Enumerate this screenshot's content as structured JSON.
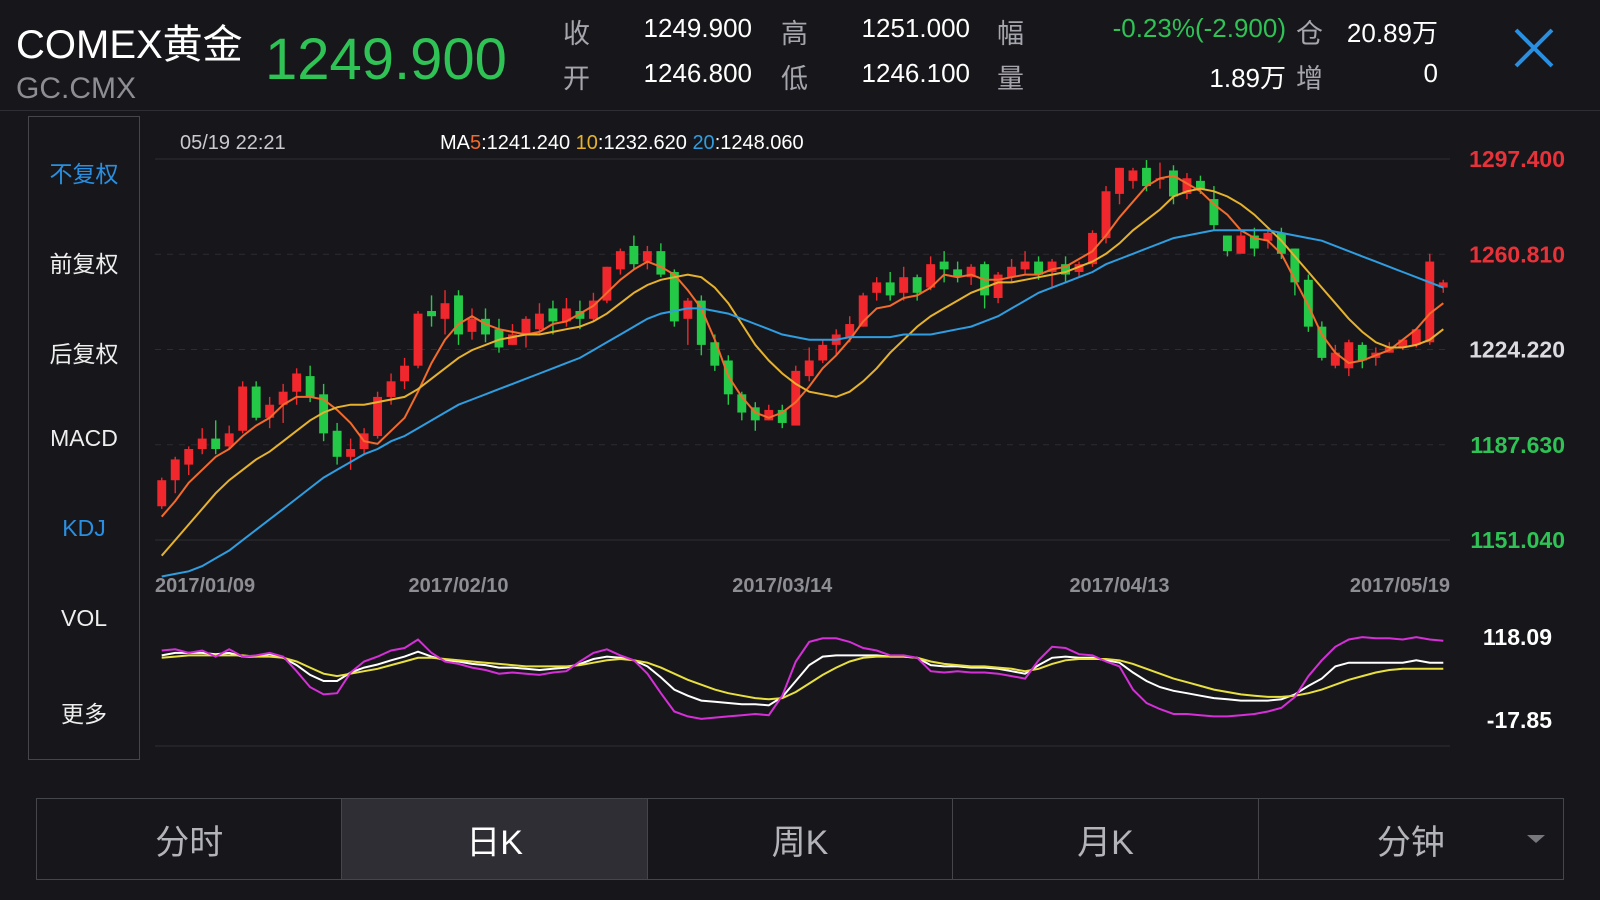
{
  "header": {
    "name": "COMEX黄金",
    "code": "GC.CMX",
    "price": "1249.900",
    "quote": [
      {
        "label": "收",
        "value": "1249.900"
      },
      {
        "label": "高",
        "value": "1251.000"
      },
      {
        "label": "幅",
        "value": "-0.23%(-2.900)"
      },
      {
        "label": "仓",
        "value": "20.89万"
      },
      {
        "label": "开",
        "value": "1246.800"
      },
      {
        "label": "低",
        "value": "1246.100"
      },
      {
        "label": "量",
        "value": "1.89万"
      },
      {
        "label": "增",
        "value": "0"
      }
    ]
  },
  "sidebar": {
    "items": [
      {
        "label": "不复权",
        "active": true
      },
      {
        "label": "前复权",
        "active": false
      },
      {
        "label": "后复权",
        "active": false
      },
      {
        "label": "MACD",
        "active": false
      },
      {
        "label": "KDJ",
        "active": true
      },
      {
        "label": "VOL",
        "active": false
      },
      {
        "label": "更多",
        "active": false
      }
    ]
  },
  "tabs": [
    {
      "label": "分时",
      "active": false
    },
    {
      "label": "日K",
      "active": true
    },
    {
      "label": "周K",
      "active": false
    },
    {
      "label": "月K",
      "active": false
    },
    {
      "label": "分钟",
      "active": false,
      "dropdown": true
    }
  ],
  "colors": {
    "up": "#f0282d",
    "down": "#25c948",
    "ma5": "#f36a2a",
    "ma10": "#e6b22e",
    "ma20": "#2f9de0",
    "kdj_k": "#ffffff",
    "kdj_d": "#e8e040",
    "kdj_j": "#d62fd8",
    "accent": "#2a8fe0",
    "price_text": "#2fc255",
    "grid": "#2c2c33"
  },
  "chart_data": [
    {
      "type": "candlestick",
      "timestamp": "05/19 22:21",
      "ma": {
        "prefix": "MA",
        "items": [
          {
            "period": "5",
            "value": "1241.240"
          },
          {
            "period": "10",
            "value": "1232.620"
          },
          {
            "period": "20",
            "value": "1248.060"
          }
        ]
      },
      "ylim": [
        1151.04,
        1297.4
      ],
      "y_ticks": [
        "1297.400",
        "1260.810",
        "1224.220",
        "1187.630",
        "1151.040"
      ],
      "x_ticks": [
        "2017/01/09",
        "2017/02/10",
        "2017/03/14",
        "2017/04/13",
        "2017/05/19"
      ],
      "x_tick_index": [
        0,
        22,
        46,
        71,
        93
      ],
      "candles": [
        [
          1164,
          1174,
          1163,
          1175
        ],
        [
          1174,
          1182,
          1169,
          1183
        ],
        [
          1180,
          1186,
          1176,
          1187
        ],
        [
          1186,
          1190,
          1184,
          1194
        ],
        [
          1190,
          1186,
          1184,
          1197
        ],
        [
          1187,
          1192,
          1186,
          1195
        ],
        [
          1193,
          1210,
          1192,
          1212
        ],
        [
          1210,
          1198,
          1197,
          1212
        ],
        [
          1198,
          1203,
          1194,
          1206
        ],
        [
          1203,
          1208,
          1196,
          1211
        ],
        [
          1208,
          1215,
          1203,
          1217
        ],
        [
          1214,
          1206,
          1204,
          1218
        ],
        [
          1207,
          1192,
          1189,
          1211
        ],
        [
          1193,
          1183,
          1180,
          1196
        ],
        [
          1183,
          1186,
          1178,
          1190
        ],
        [
          1186,
          1192,
          1184,
          1194
        ],
        [
          1191,
          1206,
          1190,
          1208
        ],
        [
          1206,
          1212,
          1203,
          1215
        ],
        [
          1212,
          1218,
          1209,
          1221
        ],
        [
          1218,
          1238,
          1217,
          1239
        ],
        [
          1239,
          1237,
          1233,
          1245
        ],
        [
          1236,
          1242,
          1230,
          1247
        ],
        [
          1245,
          1230,
          1226,
          1247
        ],
        [
          1231,
          1236,
          1228,
          1240
        ],
        [
          1236,
          1230,
          1227,
          1240
        ],
        [
          1232,
          1225,
          1223,
          1236
        ],
        [
          1226,
          1230,
          1226,
          1234
        ],
        [
          1230,
          1236,
          1225,
          1237
        ],
        [
          1232,
          1238,
          1230,
          1242
        ],
        [
          1240,
          1235,
          1230,
          1243
        ],
        [
          1235,
          1240,
          1233,
          1244
        ],
        [
          1239,
          1236,
          1232,
          1243
        ],
        [
          1236,
          1243,
          1235,
          1246
        ],
        [
          1243,
          1256,
          1242,
          1256
        ],
        [
          1255,
          1262,
          1253,
          1263
        ],
        [
          1264,
          1257,
          1255,
          1268
        ],
        [
          1258,
          1262,
          1255,
          1264
        ],
        [
          1262,
          1253,
          1252,
          1265
        ],
        [
          1254,
          1235,
          1233,
          1255
        ],
        [
          1236,
          1243,
          1226,
          1244
        ],
        [
          1243,
          1226,
          1222,
          1245
        ],
        [
          1227,
          1218,
          1216,
          1230
        ],
        [
          1220,
          1207,
          1203,
          1222
        ],
        [
          1207,
          1200,
          1197,
          1208
        ],
        [
          1202,
          1197,
          1193,
          1204
        ],
        [
          1197,
          1201,
          1197,
          1203
        ],
        [
          1201,
          1196,
          1194,
          1203
        ],
        [
          1195,
          1216,
          1196,
          1218
        ],
        [
          1214,
          1220,
          1212,
          1225
        ],
        [
          1220,
          1226,
          1219,
          1228
        ],
        [
          1226,
          1230,
          1222,
          1232
        ],
        [
          1229,
          1234,
          1227,
          1237
        ],
        [
          1233,
          1245,
          1233,
          1246
        ],
        [
          1246,
          1250,
          1243,
          1252
        ],
        [
          1250,
          1245,
          1243,
          1254
        ],
        [
          1246,
          1252,
          1243,
          1256
        ],
        [
          1252,
          1246,
          1243,
          1253
        ],
        [
          1248,
          1257,
          1247,
          1260
        ],
        [
          1258,
          1255,
          1250,
          1262
        ],
        [
          1255,
          1252,
          1250,
          1258
        ],
        [
          1252,
          1256,
          1249,
          1257
        ],
        [
          1257,
          1245,
          1240,
          1258
        ],
        [
          1244,
          1253,
          1242,
          1254
        ],
        [
          1252,
          1256,
          1250,
          1259
        ],
        [
          1255,
          1258,
          1253,
          1262
        ],
        [
          1258,
          1253,
          1251,
          1260
        ],
        [
          1254,
          1258,
          1248,
          1259
        ],
        [
          1257,
          1253,
          1250,
          1260
        ],
        [
          1254,
          1257,
          1252,
          1258
        ],
        [
          1257,
          1269,
          1256,
          1270
        ],
        [
          1267,
          1285,
          1265,
          1287
        ],
        [
          1284,
          1294,
          1280,
          1294
        ],
        [
          1289,
          1293,
          1286,
          1294
        ],
        [
          1294,
          1287,
          1285,
          1297
        ],
        [
          1290,
          1290,
          1286,
          1296
        ],
        [
          1293,
          1283,
          1280,
          1295
        ],
        [
          1284,
          1290,
          1282,
          1292
        ],
        [
          1289,
          1286,
          1284,
          1291
        ],
        [
          1282,
          1272,
          1270,
          1287
        ],
        [
          1268,
          1262,
          1260,
          1268
        ],
        [
          1261,
          1268,
          1262,
          1270
        ],
        [
          1268,
          1263,
          1260,
          1271
        ],
        [
          1266,
          1269,
          1263,
          1270
        ],
        [
          1269,
          1261,
          1259,
          1271
        ],
        [
          1263,
          1250,
          1245,
          1263
        ],
        [
          1251,
          1233,
          1231,
          1253
        ],
        [
          1233,
          1221,
          1220,
          1235
        ],
        [
          1218,
          1223,
          1217,
          1226
        ],
        [
          1217,
          1227,
          1214,
          1228
        ],
        [
          1226,
          1220,
          1217,
          1227
        ],
        [
          1221,
          1223,
          1218,
          1225
        ],
        [
          1223,
          1225,
          1223,
          1227
        ],
        [
          1225,
          1228,
          1224,
          1228
        ],
        [
          1226,
          1232,
          1225,
          1232
        ],
        [
          1227,
          1258,
          1226,
          1261
        ],
        [
          1248,
          1250,
          1246,
          1251
        ]
      ],
      "ma5": [
        1160,
        1166,
        1173,
        1178,
        1183,
        1186,
        1191,
        1195,
        1198,
        1203,
        1206,
        1206,
        1205,
        1201,
        1196,
        1189,
        1188,
        1193,
        1198,
        1208,
        1219,
        1228,
        1234,
        1237,
        1234,
        1232,
        1231,
        1230,
        1231,
        1234,
        1235,
        1238,
        1241,
        1246,
        1251,
        1255,
        1258,
        1256,
        1253,
        1247,
        1240,
        1228,
        1214,
        1206,
        1200,
        1198,
        1200,
        1204,
        1210,
        1217,
        1222,
        1228,
        1235,
        1240,
        1241,
        1244,
        1245,
        1248,
        1253,
        1252,
        1253,
        1251,
        1251,
        1252,
        1253,
        1253,
        1255,
        1256,
        1259,
        1262,
        1268,
        1275,
        1281,
        1287,
        1290,
        1291,
        1288,
        1285,
        1280,
        1276,
        1270,
        1267,
        1266,
        1261,
        1251,
        1241,
        1230,
        1223,
        1219,
        1220,
        1222,
        1224,
        1228,
        1232,
        1238,
        1242
      ],
      "ma10": [
        1145,
        1151,
        1157,
        1163,
        1169,
        1174,
        1178,
        1182,
        1185,
        1189,
        1193,
        1197,
        1200,
        1202,
        1203,
        1203,
        1204,
        1205,
        1206,
        1209,
        1213,
        1217,
        1221,
        1224,
        1226,
        1228,
        1229,
        1230,
        1230,
        1231,
        1232,
        1233,
        1235,
        1238,
        1242,
        1246,
        1249,
        1251,
        1252,
        1253,
        1252,
        1248,
        1242,
        1234,
        1226,
        1220,
        1215,
        1211,
        1208,
        1207,
        1206,
        1208,
        1212,
        1217,
        1223,
        1228,
        1233,
        1237,
        1240,
        1243,
        1246,
        1248,
        1250,
        1250,
        1251,
        1252,
        1253,
        1254,
        1256,
        1258,
        1261,
        1265,
        1270,
        1274,
        1278,
        1283,
        1285,
        1286,
        1285,
        1283,
        1280,
        1276,
        1271,
        1266,
        1260,
        1254,
        1248,
        1242,
        1236,
        1231,
        1227,
        1225,
        1225,
        1226,
        1228,
        1232
      ],
      "ma20": [
        1137,
        1138,
        1139,
        1141,
        1144,
        1147,
        1151,
        1155,
        1159,
        1163,
        1167,
        1171,
        1175,
        1178,
        1181,
        1184,
        1186,
        1189,
        1191,
        1194,
        1197,
        1200,
        1203,
        1205,
        1207,
        1209,
        1211,
        1213,
        1215,
        1217,
        1219,
        1221,
        1224,
        1227,
        1230,
        1233,
        1236,
        1238,
        1239,
        1240,
        1240,
        1239,
        1238,
        1236,
        1234,
        1232,
        1230,
        1229,
        1228,
        1228,
        1228,
        1229,
        1229,
        1229,
        1229,
        1230,
        1230,
        1230,
        1231,
        1232,
        1233,
        1235,
        1237,
        1240,
        1243,
        1246,
        1248,
        1250,
        1252,
        1254,
        1257,
        1259,
        1261,
        1263,
        1265,
        1267,
        1268,
        1269,
        1270,
        1270,
        1270,
        1270,
        1270,
        1269,
        1268,
        1267,
        1266,
        1264,
        1262,
        1260,
        1258,
        1256,
        1254,
        1252,
        1250,
        1248
      ]
    },
    {
      "type": "line",
      "name": "KDJ",
      "ylim": [
        -17.85,
        118.09
      ],
      "y_ticks": [
        "118.09",
        "-17.85"
      ],
      "series": [
        {
          "name": "K",
          "values": [
            88,
            92,
            92,
            92,
            90,
            92,
            86,
            86,
            90,
            84,
            72,
            56,
            46,
            46,
            60,
            68,
            73,
            80,
            86,
            94,
            86,
            80,
            78,
            74,
            72,
            68,
            68,
            66,
            64,
            66,
            68,
            74,
            82,
            86,
            84,
            80,
            70,
            52,
            32,
            22,
            14,
            12,
            10,
            8,
            8,
            6,
            20,
            46,
            72,
            86,
            88,
            88,
            88,
            88,
            86,
            86,
            84,
            72,
            70,
            70,
            68,
            68,
            66,
            62,
            58,
            72,
            84,
            86,
            84,
            84,
            80,
            76,
            60,
            46,
            36,
            30,
            26,
            22,
            18,
            16,
            14,
            14,
            14,
            16,
            24,
            38,
            50,
            70,
            76,
            76,
            76,
            76,
            76,
            80,
            76,
            76
          ]
        },
        {
          "name": "D",
          "values": [
            84,
            86,
            88,
            88,
            88,
            88,
            88,
            86,
            86,
            84,
            78,
            68,
            58,
            54,
            58,
            62,
            66,
            72,
            78,
            84,
            84,
            82,
            80,
            78,
            76,
            74,
            72,
            70,
            70,
            70,
            70,
            72,
            76,
            80,
            82,
            80,
            76,
            68,
            58,
            48,
            40,
            32,
            26,
            22,
            18,
            16,
            18,
            28,
            42,
            56,
            68,
            78,
            84,
            86,
            86,
            86,
            84,
            78,
            74,
            72,
            70,
            70,
            68,
            66,
            62,
            66,
            74,
            80,
            82,
            82,
            82,
            80,
            74,
            66,
            58,
            50,
            44,
            38,
            32,
            28,
            24,
            22,
            20,
            20,
            22,
            26,
            32,
            40,
            48,
            54,
            60,
            64,
            66,
            66,
            66,
            66
          ]
        },
        {
          "name": "J",
          "values": [
            96,
            98,
            92,
            96,
            86,
            98,
            86,
            88,
            92,
            86,
            62,
            36,
            24,
            26,
            60,
            78,
            86,
            96,
            100,
            114,
            92,
            78,
            74,
            68,
            64,
            58,
            60,
            58,
            56,
            60,
            62,
            78,
            92,
            98,
            88,
            80,
            58,
            26,
            -4,
            -12,
            -16,
            -14,
            -12,
            -10,
            -8,
            -10,
            22,
            78,
            110,
            116,
            116,
            110,
            100,
            96,
            88,
            88,
            84,
            62,
            60,
            62,
            60,
            60,
            58,
            54,
            50,
            80,
            102,
            100,
            90,
            88,
            78,
            70,
            32,
            10,
            0,
            -8,
            -8,
            -10,
            -12,
            -12,
            -10,
            -8,
            -4,
            2,
            20,
            54,
            80,
            102,
            114,
            118,
            116,
            116,
            114,
            118,
            114,
            112
          ]
        }
      ]
    }
  ]
}
